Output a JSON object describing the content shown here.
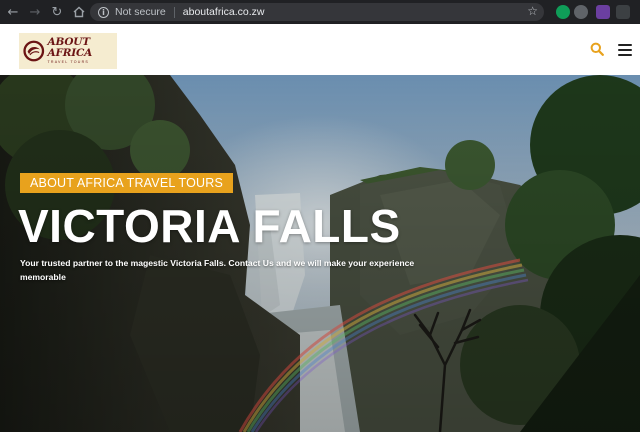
{
  "browser": {
    "security_label": "Not secure",
    "url": "aboutafrica.co.zw"
  },
  "header": {
    "logo_title": "ABOUT AFRICA",
    "logo_subtitle": "TRAVEL TOURS",
    "accent_color": "#e8a21d",
    "icons": [
      "search-icon",
      "hamburger-menu-icon"
    ]
  },
  "hero": {
    "badge": "ABOUT AFRICA TRAVEL TOURS",
    "title": "VICTORIA FALLS",
    "description": "Your trusted partner to the magestic Victoria Falls. Contact Us and we will make your experience memorable"
  }
}
